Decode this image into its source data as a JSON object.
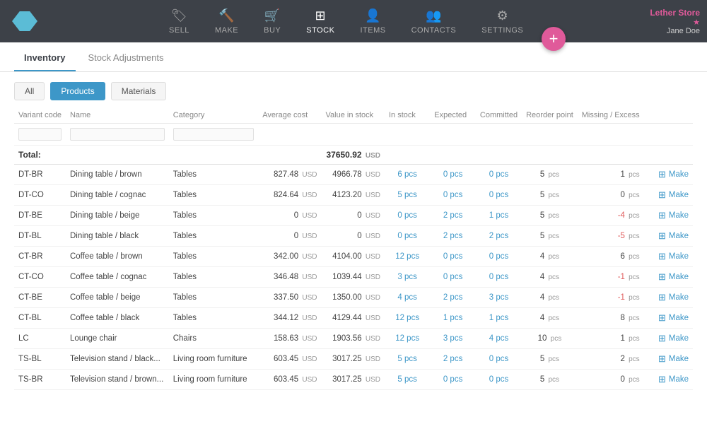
{
  "topnav": {
    "logo_alt": "App Logo",
    "items": [
      {
        "id": "sell",
        "label": "SELL",
        "icon": "🏷"
      },
      {
        "id": "make",
        "label": "MAKE",
        "icon": "🔨"
      },
      {
        "id": "buy",
        "label": "BUY",
        "icon": "🛒"
      },
      {
        "id": "stock",
        "label": "STOCK",
        "icon": "⊞",
        "active": true
      },
      {
        "id": "items",
        "label": "ITEMS",
        "icon": "👤"
      },
      {
        "id": "contacts",
        "label": "CONTACTS",
        "icon": "👥"
      },
      {
        "id": "settings",
        "label": "SETTINGS",
        "icon": "⚙"
      }
    ],
    "store_name": "Lether Store",
    "user_name": "Jane Doe"
  },
  "fab_label": "+",
  "page_tabs": [
    {
      "id": "inventory",
      "label": "Inventory",
      "active": true
    },
    {
      "id": "stock-adjustments",
      "label": "Stock Adjustments",
      "active": false
    }
  ],
  "filter_buttons": [
    {
      "id": "all",
      "label": "All",
      "active": false
    },
    {
      "id": "products",
      "label": "Products",
      "active": true
    },
    {
      "id": "materials",
      "label": "Materials",
      "active": false
    }
  ],
  "table": {
    "headers": [
      "Variant code",
      "Name",
      "Category",
      "Average cost",
      "Value in stock",
      "In stock",
      "Expected",
      "Committed",
      "Reorder point",
      "Missing / Excess",
      ""
    ],
    "total_label": "Total:",
    "total_value": "37650.92",
    "total_currency": "USD",
    "rows": [
      {
        "variant": "DT-BR",
        "name": "Dining table / brown",
        "category": "Tables",
        "avg_cost": "827.48",
        "avg_cur": "USD",
        "val_stock": "4966.78",
        "val_cur": "USD",
        "in_stock": "6 pcs",
        "expected": "0 pcs",
        "committed": "0 pcs",
        "reorder": "5",
        "missing": "1",
        "missing_color": "normal",
        "make_label": "Make"
      },
      {
        "variant": "DT-CO",
        "name": "Dining table / cognac",
        "category": "Tables",
        "avg_cost": "824.64",
        "avg_cur": "USD",
        "val_stock": "4123.20",
        "val_cur": "USD",
        "in_stock": "5 pcs",
        "expected": "0 pcs",
        "committed": "0 pcs",
        "reorder": "5",
        "missing": "0",
        "missing_color": "normal",
        "make_label": "Make"
      },
      {
        "variant": "DT-BE",
        "name": "Dining table / beige",
        "category": "Tables",
        "avg_cost": "0",
        "avg_cur": "USD",
        "val_stock": "0",
        "val_cur": "USD",
        "in_stock": "0 pcs",
        "expected": "2 pcs",
        "committed": "1 pcs",
        "reorder": "5",
        "missing": "-4",
        "missing_color": "red",
        "make_label": "Make"
      },
      {
        "variant": "DT-BL",
        "name": "Dining table / black",
        "category": "Tables",
        "avg_cost": "0",
        "avg_cur": "USD",
        "val_stock": "0",
        "val_cur": "USD",
        "in_stock": "0 pcs",
        "expected": "2 pcs",
        "committed": "2 pcs",
        "reorder": "5",
        "missing": "-5",
        "missing_color": "red",
        "make_label": "Make"
      },
      {
        "variant": "CT-BR",
        "name": "Coffee table / brown",
        "category": "Tables",
        "avg_cost": "342.00",
        "avg_cur": "USD",
        "val_stock": "4104.00",
        "val_cur": "USD",
        "in_stock": "12 pcs",
        "expected": "0 pcs",
        "committed": "0 pcs",
        "reorder": "4",
        "missing": "6",
        "missing_color": "normal",
        "make_label": "Make"
      },
      {
        "variant": "CT-CO",
        "name": "Coffee table / cognac",
        "category": "Tables",
        "avg_cost": "346.48",
        "avg_cur": "USD",
        "val_stock": "1039.44",
        "val_cur": "USD",
        "in_stock": "3 pcs",
        "expected": "0 pcs",
        "committed": "0 pcs",
        "reorder": "4",
        "missing": "-1",
        "missing_color": "red",
        "make_label": "Make"
      },
      {
        "variant": "CT-BE",
        "name": "Coffee table / beige",
        "category": "Tables",
        "avg_cost": "337.50",
        "avg_cur": "USD",
        "val_stock": "1350.00",
        "val_cur": "USD",
        "in_stock": "4 pcs",
        "expected": "2 pcs",
        "committed": "3 pcs",
        "reorder": "4",
        "missing": "-1",
        "missing_color": "red",
        "make_label": "Make"
      },
      {
        "variant": "CT-BL",
        "name": "Coffee table / black",
        "category": "Tables",
        "avg_cost": "344.12",
        "avg_cur": "USD",
        "val_stock": "4129.44",
        "val_cur": "USD",
        "in_stock": "12 pcs",
        "expected": "1 pcs",
        "committed": "1 pcs",
        "reorder": "4",
        "missing": "8",
        "missing_color": "normal",
        "make_label": "Make"
      },
      {
        "variant": "LC",
        "name": "Lounge chair",
        "category": "Chairs",
        "avg_cost": "158.63",
        "avg_cur": "USD",
        "val_stock": "1903.56",
        "val_cur": "USD",
        "in_stock": "12 pcs",
        "expected": "3 pcs",
        "committed": "4 pcs",
        "reorder": "10",
        "missing": "1",
        "missing_color": "normal",
        "make_label": "Make"
      },
      {
        "variant": "TS-BL",
        "name": "Television stand / black...",
        "category": "Living room furniture",
        "avg_cost": "603.45",
        "avg_cur": "USD",
        "val_stock": "3017.25",
        "val_cur": "USD",
        "in_stock": "5 pcs",
        "expected": "2 pcs",
        "committed": "0 pcs",
        "reorder": "5",
        "missing": "2",
        "missing_color": "normal",
        "make_label": "Make"
      },
      {
        "variant": "TS-BR",
        "name": "Television stand / brown...",
        "category": "Living room furniture",
        "avg_cost": "603.45",
        "avg_cur": "USD",
        "val_stock": "3017.25",
        "val_cur": "USD",
        "in_stock": "5 pcs",
        "expected": "0 pcs",
        "committed": "0 pcs",
        "reorder": "5",
        "missing": "0",
        "missing_color": "normal",
        "make_label": "Make"
      }
    ]
  }
}
